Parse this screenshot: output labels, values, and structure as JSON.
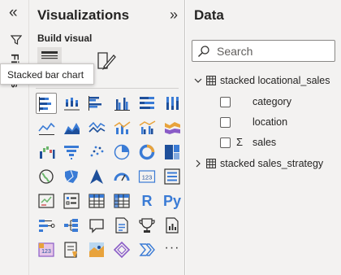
{
  "filters": {
    "label": "Filters",
    "collapse_icon": "double-chevron-left-icon"
  },
  "visualizations": {
    "title": "Visualizations",
    "expand_icon": "double-chevron-right-icon",
    "build_label": "Build visual",
    "tooltip": "Stacked bar chart",
    "selected": "stacked-bar-chart",
    "icons": [
      [
        "stacked-bar-chart",
        "stacked-column-chart",
        "clustered-bar-chart",
        "clustered-column-chart",
        "100-stacked-bar-chart",
        "100-stacked-column-chart"
      ],
      [
        "line-chart",
        "area-chart",
        "stacked-area-chart",
        "line-and-stacked-column-chart",
        "line-and-clustered-column-chart",
        "ribbon-chart"
      ],
      [
        "waterfall-chart",
        "funnel-chart",
        "scatter-chart",
        "pie-chart",
        "donut-chart",
        "treemap"
      ],
      [
        "map",
        "filled-map",
        "azure-map",
        "gauge",
        "card",
        "multi-row-card"
      ],
      [
        "kpi",
        "slicer",
        "table",
        "matrix",
        "r-script-visual",
        "python-visual"
      ],
      [
        "key-influencers",
        "decomposition-tree",
        "q-and-a",
        "smart-narrative",
        "metrics",
        "paginated-report"
      ],
      [
        "power-apps",
        "power-automate",
        "arcgis-maps",
        "power-apps-diamond",
        "power-automate-chevrons",
        "more-visuals"
      ]
    ],
    "text_glyphs": {
      "r-script-visual": "R",
      "python-visual": "Py",
      "more-visuals": "···",
      "card": "123"
    }
  },
  "data": {
    "title": "Data",
    "search_placeholder": "Search",
    "tables": [
      {
        "name": "stacked locational_sales",
        "expanded": true,
        "fields": [
          {
            "name": "category",
            "sigma": false
          },
          {
            "name": "location",
            "sigma": false
          },
          {
            "name": "sales",
            "sigma": true
          }
        ]
      },
      {
        "name": "stacked sales_strategy",
        "expanded": false,
        "fields": []
      }
    ],
    "sigma_glyph": "Σ"
  }
}
